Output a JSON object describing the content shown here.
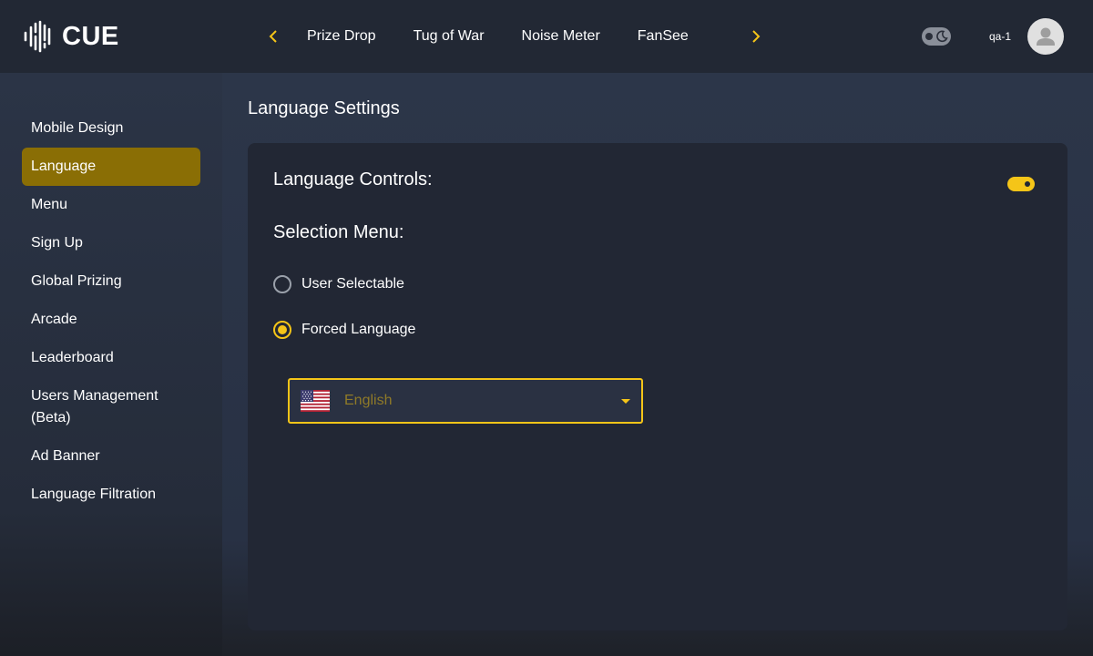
{
  "app": {
    "logo_text": "CUE"
  },
  "header": {
    "tabs": [
      "Prize Drop",
      "Tug of War",
      "Noise Meter",
      "FanSee"
    ],
    "username": "qa-1"
  },
  "sidebar": {
    "items": [
      {
        "label": "Mobile Design",
        "active": false
      },
      {
        "label": "Language",
        "active": true
      },
      {
        "label": "Menu",
        "active": false
      },
      {
        "label": "Sign Up",
        "active": false
      },
      {
        "label": "Global Prizing",
        "active": false
      },
      {
        "label": "Arcade",
        "active": false
      },
      {
        "label": "Leaderboard",
        "active": false
      },
      {
        "label": "Users Management (Beta)",
        "active": false
      },
      {
        "label": "Ad Banner",
        "active": false
      },
      {
        "label": "Language Filtration",
        "active": false
      }
    ]
  },
  "main": {
    "page_title": "Language Settings",
    "controls_label": "Language Controls:",
    "controls_enabled": true,
    "selection_label": "Selection Menu:",
    "options": [
      {
        "label": "User Selectable",
        "checked": false
      },
      {
        "label": "Forced Language",
        "checked": true
      }
    ],
    "language_select": {
      "value": "English",
      "flag": "us-flag-icon"
    }
  },
  "colors": {
    "accent": "#f5c518",
    "active_nav": "#8a6e05",
    "card_bg": "#222734",
    "topbar_bg": "#222834"
  },
  "icons": {
    "logo": "cue-soundwave-logo-icon",
    "prev": "chevron-left-icon",
    "next": "chevron-right-icon",
    "theme": "moon-icon",
    "avatar": "user-avatar-icon",
    "dropdown": "caret-down-icon"
  }
}
